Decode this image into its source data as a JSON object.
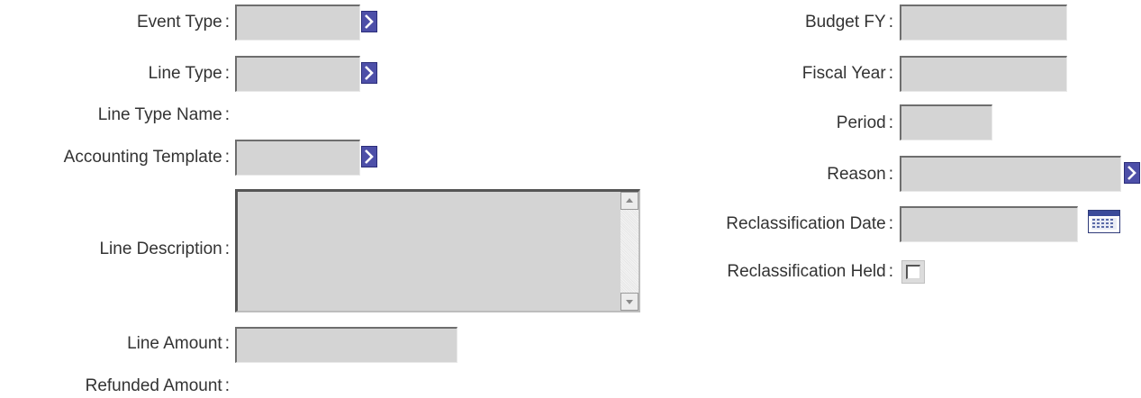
{
  "left": {
    "event_type": {
      "label": "Event Type",
      "value": ""
    },
    "line_type": {
      "label": "Line Type",
      "value": ""
    },
    "line_type_name": {
      "label": "Line Type Name",
      "value": ""
    },
    "accounting_template": {
      "label": "Accounting Template",
      "value": ""
    },
    "line_description": {
      "label": "Line Description",
      "value": ""
    },
    "line_amount": {
      "label": "Line Amount",
      "value": ""
    },
    "refunded_amount": {
      "label": "Refunded Amount",
      "value": ""
    }
  },
  "right": {
    "budget_fy": {
      "label": "Budget FY",
      "value": ""
    },
    "fiscal_year": {
      "label": "Fiscal Year",
      "value": ""
    },
    "period": {
      "label": "Period",
      "value": ""
    },
    "reason": {
      "label": "Reason",
      "value": ""
    },
    "reclassification_date": {
      "label": "Reclassification Date",
      "value": ""
    },
    "reclassification_held": {
      "label": "Reclassification Held",
      "checked": false
    }
  },
  "colon": ":",
  "icons": {
    "lookup": "chevron-right-icon",
    "calendar": "calendar-icon",
    "scroll_up": "scroll-up-icon",
    "scroll_down": "scroll-down-icon"
  },
  "colors": {
    "accent": "#4d4fa8",
    "field_bg": "#d4d4d4",
    "text": "#333333"
  }
}
